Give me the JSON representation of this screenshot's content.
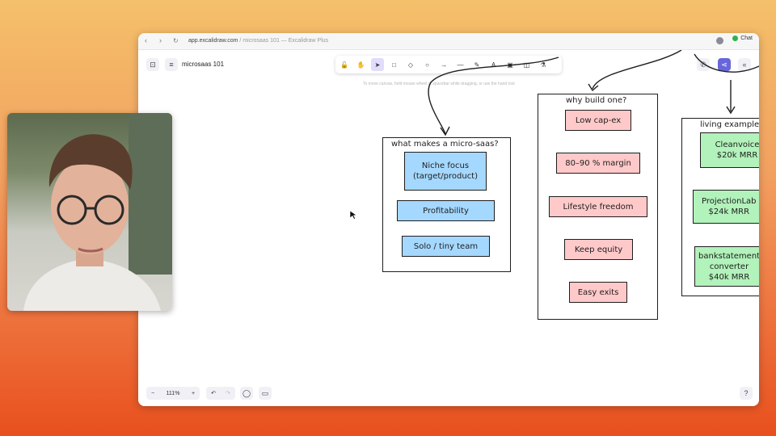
{
  "browser": {
    "url_host": "app.excalidraw.com",
    "url_rest": " / microsaas 101 — Excalidraw Plus",
    "chat_label": "Chat"
  },
  "app": {
    "file_name": "microsaas 101",
    "hint": "To move canvas, hold mouse wheel or spacebar while dragging, or use the hand tool",
    "zoom": "111%",
    "toolbar_tools": [
      {
        "icon": "lock-icon",
        "glyph": "🔓"
      },
      {
        "icon": "hand-icon",
        "glyph": "✋"
      },
      {
        "icon": "selection-icon",
        "glyph": "➤"
      },
      {
        "icon": "rectangle-icon",
        "glyph": "□"
      },
      {
        "icon": "diamond-icon",
        "glyph": "◇"
      },
      {
        "icon": "ellipse-icon",
        "glyph": "○"
      },
      {
        "icon": "arrow-icon",
        "glyph": "→"
      },
      {
        "icon": "line-icon",
        "glyph": "—"
      },
      {
        "icon": "draw-icon",
        "glyph": "✎"
      },
      {
        "icon": "text-icon",
        "glyph": "A"
      },
      {
        "icon": "image-icon",
        "glyph": "▣"
      },
      {
        "icon": "eraser-icon",
        "glyph": "◫"
      },
      {
        "icon": "more-tools-icon",
        "glyph": "⚗"
      }
    ]
  },
  "diagram": {
    "what": {
      "title": "what makes a micro-saas?",
      "items": [
        "Niche focus\n(target/product)",
        "Profitability",
        "Solo / tiny team"
      ]
    },
    "why": {
      "title": "why build one?",
      "items": [
        "Low cap-ex",
        "80–90 % margin",
        "Lifestyle freedom",
        "Keep equity",
        "Easy exits"
      ]
    },
    "living": {
      "title": "living example",
      "items": [
        "Cleanvoice\n$20k MRR",
        "ProjectionLab\n$24k MRR",
        "bankstatement\nconverter\n$40k MRR"
      ]
    }
  },
  "colors": {
    "accent": "#6965db",
    "blue_card": "#a5d8ff",
    "pink_card": "#ffc9c9",
    "green_card": "#b2f2bb"
  }
}
